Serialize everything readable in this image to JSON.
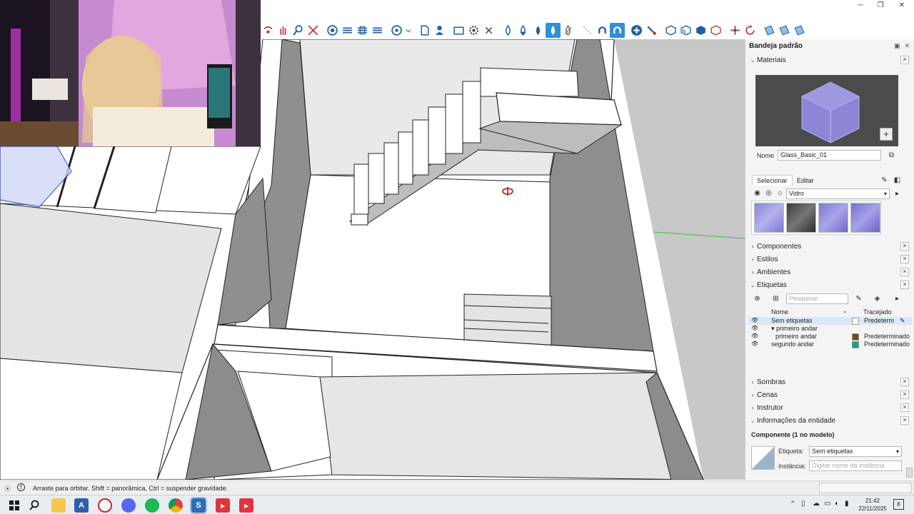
{
  "window": {
    "controls": [
      "minimize",
      "maximize",
      "close"
    ]
  },
  "toolbar": {
    "icons": [
      "orbit-icon",
      "pan-icon",
      "zoom-icon",
      "zoom-extents-icon",
      "style-xray-icon",
      "style-wireframe-icon",
      "style-hidden-line-icon",
      "style-shaded-icon",
      "style-textured-icon",
      "components-icon",
      "page-icon",
      "user-icon",
      "rectangle-icon",
      "gear-icon",
      "close-icon",
      "drop-outline-icon",
      "drop-half-icon",
      "drop-fill-icon",
      "drop-active-icon",
      "drop-strike-icon",
      "magnet-off-icon",
      "magnet-icon",
      "magnet-active-icon",
      "add-circle-icon",
      "brush-icon",
      "cube-outline-icon",
      "cube-left-icon",
      "cube-front-icon",
      "cube-red-icon",
      "axes-icon",
      "refresh-icon",
      "grid-icon",
      "grid-2-icon",
      "grid-3-icon"
    ]
  },
  "tray": {
    "title": "Bandeja padrão",
    "materials": {
      "header": "Materiais",
      "name_label": "Nome",
      "name_value": "Glass_Basic_01",
      "tab_select": "Selecionar",
      "tab_edit": "Editar",
      "library": "Vidro",
      "swatches": [
        "glass-blue-swatch",
        "glass-dark-swatch",
        "glass-blue-2-swatch",
        "glass-blue-3-swatch"
      ]
    },
    "panels": {
      "componentes": "Componentes",
      "estilos": "Estilos",
      "ambientes": "Ambientes",
      "etiquetas": "Etiquetas",
      "sombras": "Sombras",
      "cenas": "Cenas",
      "instrutor": "Instrutor",
      "info": "Informações da entidade"
    },
    "tags": {
      "search_placeholder": "Pesquisar",
      "col_name": "Nome",
      "col_dash": "Tracejado",
      "rows": [
        {
          "name": "Sem etiquetas",
          "dash": "Predeterm",
          "color": "#ffffff",
          "indent": 0,
          "selected": true
        },
        {
          "name": "▾ primeiro andar",
          "dash": "",
          "color": "",
          "indent": 0,
          "selected": false
        },
        {
          "name": "primeiro andar",
          "dash": "Predeterminado",
          "color": "#6b4c12",
          "indent": 1,
          "selected": false
        },
        {
          "name": "segundo andar",
          "dash": "Predeterminado",
          "color": "#19a287",
          "indent": 0,
          "selected": false
        }
      ]
    },
    "entity": {
      "title": "Componente (1 no modelo)",
      "tag_label": "Etiqueta:",
      "tag_value": "Sem etiquetas",
      "instance_label": "Instância:",
      "instance_placeholder": "Digitar nome da instância"
    }
  },
  "status": {
    "text": "Arraste para orbitar. Shift = panorâmica, Ctrl = suspender gravidade."
  },
  "taskbar": {
    "time": "21:42",
    "date": "22/11/2025",
    "notifications": "8",
    "apps": [
      "windows-start-icon",
      "search-icon",
      "file-explorer-icon",
      "app-a-icon",
      "opera-icon",
      "discord-icon",
      "spotify-icon",
      "chrome-icon",
      "sketchup-icon",
      "app-red-icon",
      "app-red-2-icon"
    ]
  },
  "colors": {
    "accent": "#2f8fd8",
    "wall_dark": "#8a8a8a",
    "wall_mid": "#bdbdbd",
    "floor": "#ffffff"
  }
}
